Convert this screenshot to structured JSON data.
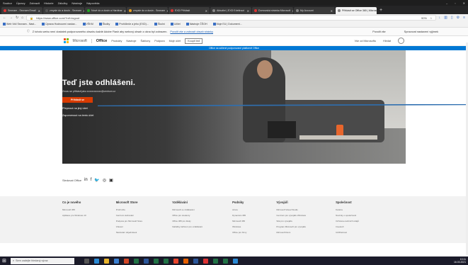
{
  "menubar": {
    "items": [
      "Soubor",
      "Úpravy",
      "Zobrazit",
      "Historie",
      "Záložky",
      "Nástroje",
      "Nápověda"
    ]
  },
  "tabs": [
    {
      "label": "Seznam - Seznam Email",
      "color": "#d33"
    },
    {
      "label": "zmysle do a dusin - Seznam",
      "color": "#555"
    },
    {
      "label": "Nové do a dusin a Hardinar",
      "color": "#2a2"
    },
    {
      "label": "zmysle do a dusin - Seznam",
      "color": "#e8a020"
    },
    {
      "label": "EXD Přihlásit",
      "color": "#d33"
    },
    {
      "label": "Aktuální | EXD Edeltraut",
      "color": "#888"
    },
    {
      "label": "Domovská stránka Microsoft",
      "color": "#d33"
    },
    {
      "label": "My Account",
      "color": "#888"
    },
    {
      "label": "Přihlásit se Office 365 | Microsoft",
      "color": "#888",
      "active": true
    }
  ],
  "address": {
    "url": "https://www.office.com/?ref=logout",
    "zoom": "90%"
  },
  "bookmarks": [
    "Web Vidí Seznam - Nast...",
    "Úprava Hodnocení nastav...",
    "VŠKM",
    "Školky",
    "Prohlížeče a jeho (EXD)...",
    "Školní",
    "Učitel",
    "Nástroje ČŠOH",
    "Moje EU | Dokument..."
  ],
  "infobar": {
    "text": "Z tohoto webu není dostatek podporovaného obsahu každé Adobe Flash aby webový obsah z okna byl zobrazen.",
    "link": "Povolit vše a zobrazit obsah stránky",
    "allow": "Povolit vše",
    "settings": "Spravovat nastavení výjimek"
  },
  "header": {
    "brand": "Microsoft",
    "product": "Office",
    "nav": [
      "Produkty",
      "Nástroje",
      "Šablony",
      "Podpora",
      "Moje účet"
    ],
    "buy": "Koupit teď",
    "all_ms": "Vše od Microsoftu",
    "search": "Hledat",
    "logo_colors": [
      "#f25022",
      "#7fba00",
      "#00a4ef",
      "#ffb900"
    ]
  },
  "banner": "Office na sdílené podporované platformě Office",
  "hero": {
    "title": "Teď jste odhlášeni.",
    "subtitle": "Znovu se přihlásit jako xxxxxxxxxxxx@centrum.cz",
    "signin": "Přihlásit se",
    "other": "Přepnout na jiný účet",
    "forget": "Zapomenout na tento účet"
  },
  "follow": {
    "label": "Sledovat Office"
  },
  "footer": {
    "columns": [
      {
        "title": "Co je nového",
        "items": [
          "Microsoft 365",
          "Aplikace pro Windows 10"
        ]
      },
      {
        "title": "Microsoft Store",
        "items": [
          "Profil účtu",
          "Centrum stahování",
          "Podpora pro Microsoft Store",
          "Vrácení",
          "Sledování objednávek"
        ]
      },
      {
        "title": "Vzdělávání",
        "items": [
          "Microsoft ve vzdělávání",
          "Office pro studenty",
          "Office 365 pro školy",
          "Nabídky zařízení pro vzdělávání"
        ]
      },
      {
        "title": "Podniky",
        "items": [
          "Azure",
          "Dynamics 365",
          "Microsoft 365",
          "Windows",
          "Office pro firmy"
        ]
      },
      {
        "title": "Vývojáři",
        "items": [
          "Microsoft Visual Studio",
          "Centrum pro vývojáře Windows",
          "Sítě pro vývojáře",
          "Program Microsoft pro vývojáře",
          "Microsoft Docs"
        ]
      },
      {
        "title": "Společnost",
        "items": [
          "Kariéra",
          "Novinky o společnosti",
          "Ochrana osobních údajů",
          "Investoři",
          "Udržitelnost"
        ]
      }
    ]
  },
  "taskbar": {
    "search": "Sem zadejte hledaný výraz",
    "time": "10:11",
    "date": "16.03.2021"
  }
}
